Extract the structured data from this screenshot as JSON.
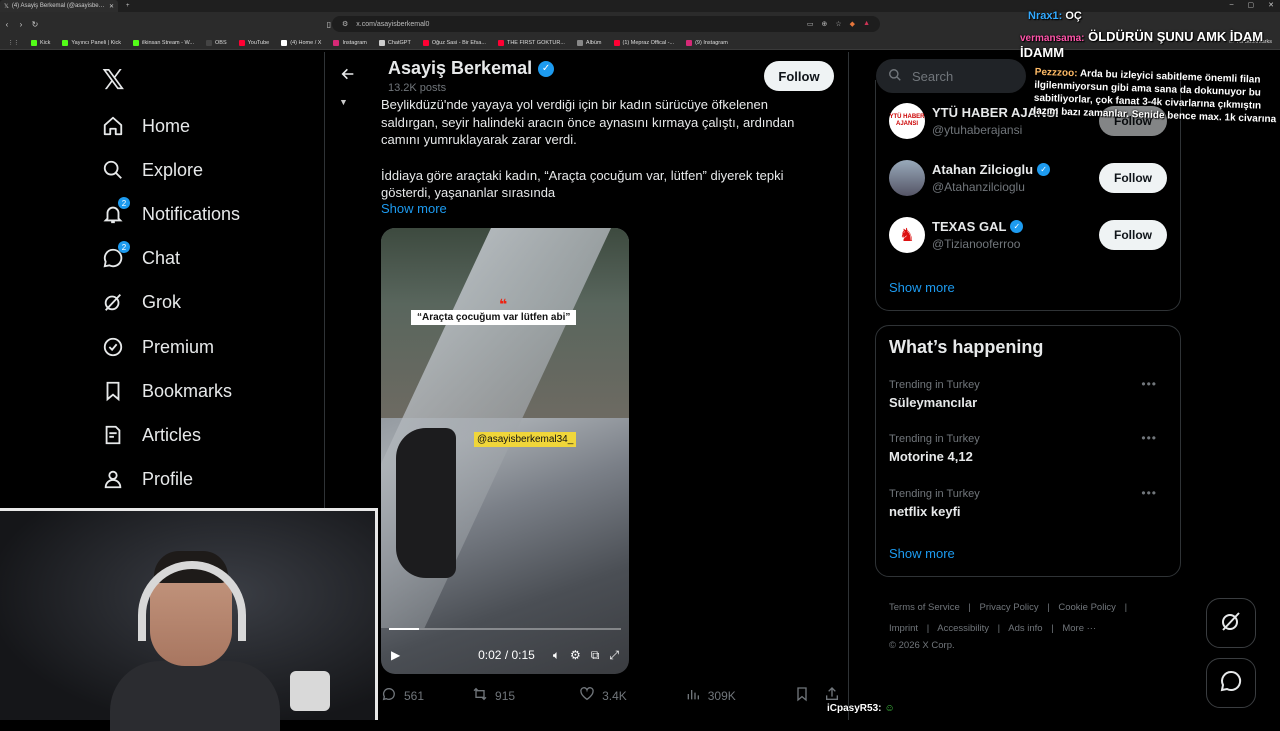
{
  "browser": {
    "tab_title": "(4) Asayiş Berkemal (@asayisbe…",
    "new_tab": "+",
    "window_controls": [
      "–",
      "▢",
      "✕"
    ],
    "url": "x.com/asayisberkemal0",
    "bookmarks": [
      {
        "label": "Kick",
        "color": "#53fc18"
      },
      {
        "label": "Yayıncı Paneli | Kick",
        "color": "#53fc18"
      },
      {
        "label": "ilkinsan Stream - W...",
        "color": "#53fc18"
      },
      {
        "label": "OBS",
        "color": "#444444"
      },
      {
        "label": "YouTube",
        "color": "#ff0033"
      },
      {
        "label": "(4) Home / X",
        "color": "#ffffff"
      },
      {
        "label": "Instagram",
        "color": "#d62976"
      },
      {
        "label": "ChatGPT",
        "color": "#cccccc"
      },
      {
        "label": "Oğuz Sasi - Bir Efsa...",
        "color": "#ff0033"
      },
      {
        "label": "THE FIRST GOKTUR...",
        "color": "#ff0033"
      },
      {
        "label": "Albüm",
        "color": "#888888"
      },
      {
        "label": "(1) Mepraz Offical -...",
        "color": "#ff0033"
      },
      {
        "label": "(9) Instagram",
        "color": "#d62976"
      }
    ],
    "all_bookmarks": "All Bookmarks"
  },
  "sidebar": {
    "logo": "𝕏",
    "items": [
      {
        "label": "Home",
        "icon": "home-icon",
        "badge": ""
      },
      {
        "label": "Explore",
        "icon": "search-icon",
        "badge": ""
      },
      {
        "label": "Notifications",
        "icon": "bell-icon",
        "badge": "2"
      },
      {
        "label": "Chat",
        "icon": "chat-icon",
        "badge": "2"
      },
      {
        "label": "Grok",
        "icon": "grok-icon",
        "badge": ""
      },
      {
        "label": "Premium",
        "icon": "premium-icon",
        "badge": ""
      },
      {
        "label": "Bookmarks",
        "icon": "bookmark-icon",
        "badge": ""
      },
      {
        "label": "Articles",
        "icon": "articles-icon",
        "badge": ""
      },
      {
        "label": "Profile",
        "icon": "profile-icon",
        "badge": ""
      }
    ]
  },
  "profile_header": {
    "name": "Asayiş Berkemal",
    "posts": "13.2K posts",
    "follow_label": "Follow"
  },
  "tweet": {
    "paragraph1": "Beylikdüzü'nde yayaya yol verdiği için bir kadın sürücüye öfkelenen saldırgan, seyir halindeki aracın önce aynasını kırmaya çalıştı, ardından camını yumruklayarak zarar verdi.",
    "paragraph2": "İddiaya göre araçtaki kadın, “Araçta çocuğum var, lütfen” diyerek tepki gösterdi, yaşananlar sırasında",
    "show_more": "Show more",
    "video": {
      "caption": "“Araçta çocuğum var lütfen abi”",
      "quote_mark": "❝",
      "tag": "@asayisberkemal34_",
      "time": "0:02 / 0:15",
      "progress": 0.13
    },
    "stats": {
      "replies": "561",
      "reposts": "915",
      "likes": "3.4K",
      "views": "309K"
    }
  },
  "right": {
    "search_placeholder": "Search",
    "who_to_follow": [
      {
        "name": "YTÜ HABER AJANSI",
        "handle": "@ytuhaberajansi",
        "verified": false,
        "avatar_text": "YTÜ HABER AJANSI",
        "follow": "Follow"
      },
      {
        "name": "Atahan Zilcioglu",
        "handle": "@Atahanzilcioglu",
        "verified": true,
        "avatar_text": "",
        "follow": "Follow"
      },
      {
        "name": "TEXAS GAL",
        "handle": "@Tizianooferroo",
        "verified": true,
        "avatar_text": "",
        "follow": "Follow"
      }
    ],
    "wtf_show_more": "Show more",
    "happening_title": "What’s happening",
    "trends": [
      {
        "context": "Trending in Turkey",
        "name": "Süleymancılar"
      },
      {
        "context": "Trending in Turkey",
        "name": "Motorine 4,12"
      },
      {
        "context": "Trending in Turkey",
        "name": "netflix keyfi"
      }
    ],
    "trends_show_more": "Show more",
    "footer_links": [
      "Terms of Service",
      "|",
      "Privacy Policy",
      "|",
      "Cookie Policy",
      "|",
      "Imprint",
      "|",
      "Accessibility",
      "|",
      "Ads info",
      "|",
      "More ···"
    ],
    "copyright": "© 2026 X Corp."
  },
  "stream_chat": [
    {
      "user": "Nrax1:",
      "msg": "OÇ"
    },
    {
      "user": "vermansama:",
      "msg": "ÖLDÜRÜN ŞUNU AMK İDAM İDAMM"
    },
    {
      "user": "Pezzzoo:",
      "msg": "Arda bu izleyici sabitleme önemli filan ilgilenmiyorsun gibi ama sana da dokunuyor bu sabitliyorlar, çok fanat 3-4k civarlarına çıkmıştın lazım bazı zamanlar. Senide bence max. 1k civarına"
    }
  ],
  "stream_bottom_user": "iCpasyR53:"
}
